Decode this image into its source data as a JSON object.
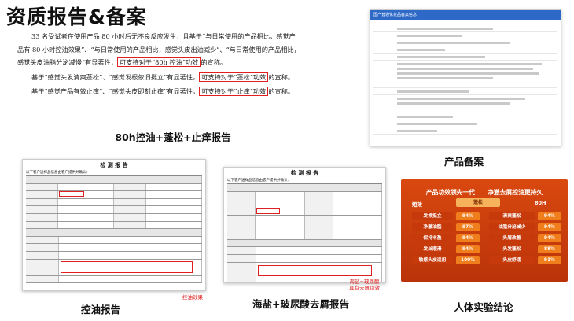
{
  "title": "资质报告&备案",
  "main_report": {
    "paragraphs": [
      [
        "33 名受试者在使用产品 80 小时后无不良反应发生，且基于“与日常使用的产品相比，感觉产品有 80 小时控油效果”、“与日常使用的产品相比，感觉头皮出油减少”、“与日常使用的产品相比，感觉头皮油脂分泌减慢”有显著性，",
        "可支持对于“80h 控油”功效",
        "的宣称。"
      ],
      [
        "基于“感觉头发清爽蓬松”、“感觉发根依旧挺立”有显著性，",
        "可支持对于“蓬松”功效",
        "的宣称。"
      ],
      [
        "基于“感觉产品有效止痒”、“感觉头皮即刻止痒”有显著性，",
        "可支持对于“止痒”功效",
        "的宣称。"
      ]
    ]
  },
  "captions": {
    "main_report": "80h控油+蓬松+止痒报告",
    "product_filing": "产品备案",
    "oil_report": "控油报告",
    "salt_report": "海盐+玻尿酸去屑报告",
    "human_test": "人体实验结论"
  },
  "product_filing": {
    "header": "国产普通化妆品备案信息"
  },
  "oil_report": {
    "heading": "检 测 报 告",
    "subheading": "以下客户送样品信息由客户提供并确认：",
    "red_note": "控油效果"
  },
  "salt_report": {
    "heading": "检 测 报 告",
    "subheading": "以下客户送样品信息由客户提供并确认：",
    "red_note": "海盐+玻尿酸",
    "red_note2": "具有去屑功效"
  },
  "human_test": {
    "headline_left": "产品功效领先一代",
    "headline_right": "净澈去屑控油更持久",
    "col_short": "短效",
    "col_mid": "蓬松",
    "col_long": "80H",
    "rows_left": [
      {
        "label": "发根挺立",
        "value": "94%"
      },
      {
        "label": "净澈油脂",
        "value": "97%"
      },
      {
        "label": "保持丰盈",
        "value": "94%"
      },
      {
        "label": "发丝顺滑",
        "value": "94%"
      },
      {
        "label": "敏感头皮适用",
        "value": "100%"
      }
    ],
    "rows_right": [
      {
        "label": "清爽蓬松",
        "value": "94%"
      },
      {
        "label": "油脂分泌减少",
        "value": "94%"
      },
      {
        "label": "头屑改善",
        "value": "94%"
      },
      {
        "label": "头发蓬松",
        "value": "88%"
      },
      {
        "label": "头皮舒适",
        "value": "91%"
      }
    ]
  }
}
